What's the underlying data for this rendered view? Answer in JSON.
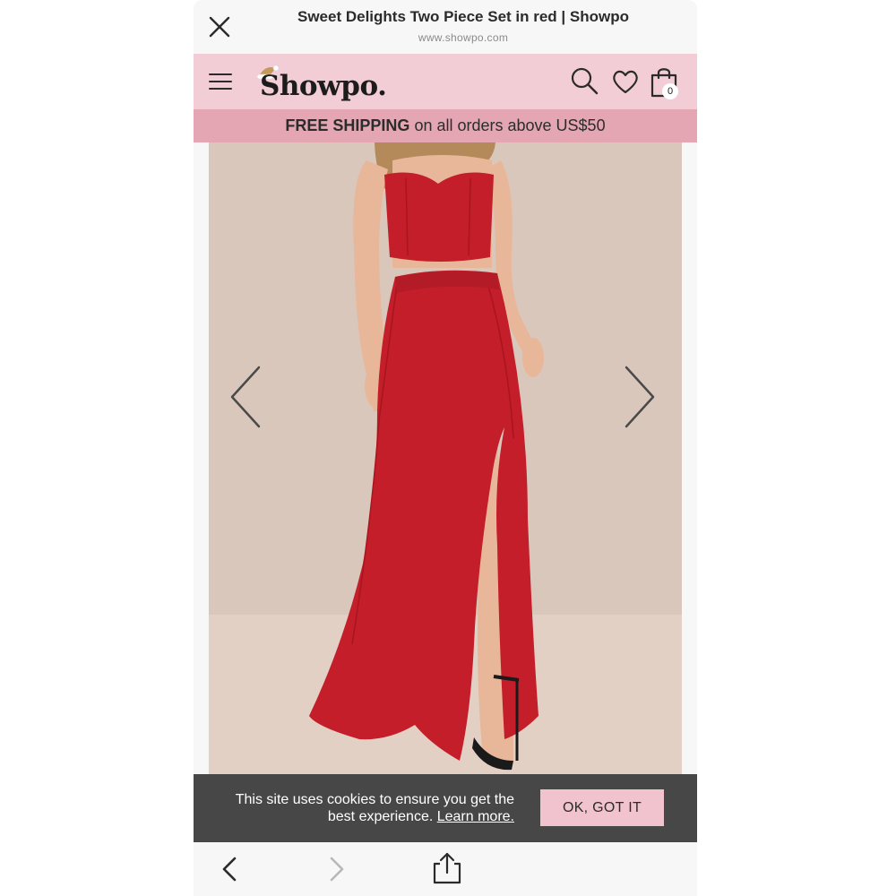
{
  "browser": {
    "title": "Sweet Delights Two Piece Set in red | Showpo",
    "url": "www.showpo.com",
    "close_icon": "close-icon"
  },
  "header": {
    "logo": "Showpo.",
    "menu_icon": "hamburger-menu-icon",
    "search_icon": "search-icon",
    "wishlist_icon": "heart-icon",
    "cart_icon": "shopping-bag-icon",
    "cart_count": "0",
    "background": "#f3cdd6"
  },
  "promo": {
    "strong": "FREE SHIPPING",
    "rest": " on all orders above US$50",
    "background": "#e5a6b4"
  },
  "product_image": {
    "prev_icon": "chevron-left-icon",
    "next_icon": "chevron-right-icon",
    "dress_color": "#c41e2a"
  },
  "cookie": {
    "text": "This site uses cookies to ensure you get the best experience.",
    "link": "Learn more.",
    "button": "OK, GOT IT",
    "button_color": "#f1c3cf"
  },
  "bottom_nav": {
    "back_icon": "back-arrow-icon",
    "forward_icon": "forward-arrow-icon",
    "share_icon": "share-icon"
  }
}
